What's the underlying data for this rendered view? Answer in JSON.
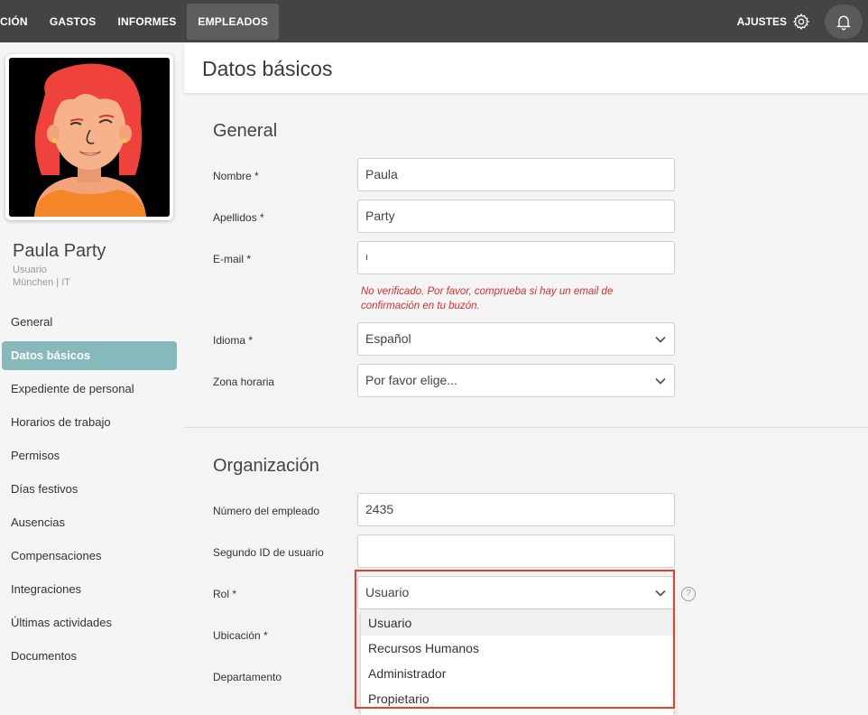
{
  "topnav": {
    "items": [
      "CIÓN",
      "GASTOS",
      "INFORMES",
      "EMPLEADOS"
    ],
    "settings_label": "AJUSTES"
  },
  "profile": {
    "name": "Paula Party",
    "role": "Usuario",
    "location": "München | IT"
  },
  "sidebar": {
    "items": [
      "General",
      "Datos básicos",
      "Expediente de personal",
      "Horarios de trabajo",
      "Permisos",
      "Días festivos",
      "Ausencias",
      "Compensaciones",
      "Integraciones",
      "Últimas actividades",
      "Documentos"
    ],
    "active": "Datos básicos"
  },
  "page": {
    "title": "Datos básicos"
  },
  "general": {
    "title": "General",
    "first_name_label": "Nombre *",
    "first_name": "Paula",
    "last_name_label": "Apellidos *",
    "last_name": "Party",
    "email_label": "E-mail *",
    "email": "ı",
    "email_error": "No verificado. Por favor, comprueba si hay un email de confirmación en tu buzón.",
    "language_label": "Idioma *",
    "language": "Español",
    "timezone_label": "Zona horaria",
    "timezone": "Por favor elige..."
  },
  "organization": {
    "title": "Organización",
    "employee_number_label": "Número del empleado",
    "employee_number": "2435",
    "second_id_label": "Segundo ID de usuario",
    "second_id": "",
    "role_label": "Rol *",
    "role": "Usuario",
    "location_label": "Ubicación *",
    "department_label": "Departamento",
    "help_icon": "?"
  },
  "role_dropdown": {
    "options": [
      "Usuario",
      "Recursos Humanos",
      "Administrador",
      "Propietario"
    ],
    "selected": "Usuario"
  },
  "colors": {
    "topbar": "#444444",
    "sidebar_active": "#87b9bb",
    "error": "#d9302b",
    "highlight": "#e8402b"
  },
  "icons": [
    "gear-icon",
    "bell-icon",
    "chevron-down-icon",
    "help-icon"
  ]
}
